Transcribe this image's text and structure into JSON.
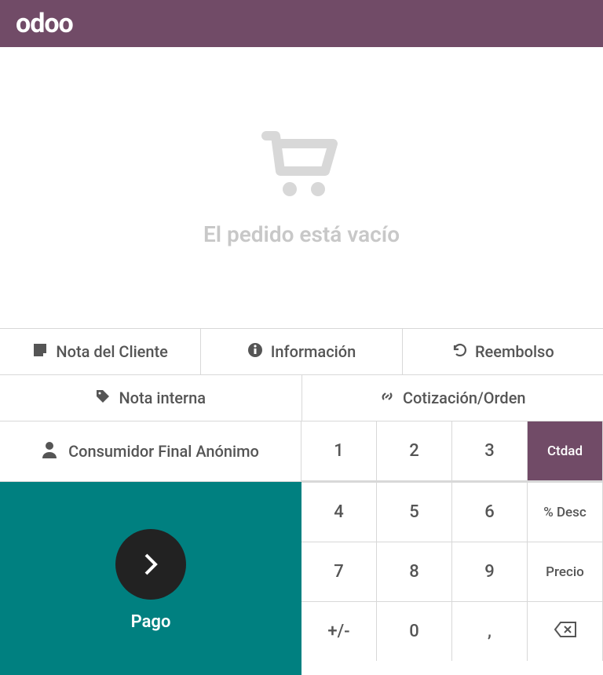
{
  "header": {
    "logo": "odoo"
  },
  "cart": {
    "empty_text": "El pedido está vacío"
  },
  "actions_row1": {
    "customer_note": "Nota del Cliente",
    "info": "Información",
    "refund": "Reembolso"
  },
  "actions_row2": {
    "internal_note": "Nota interna",
    "quotation": "Cotización/Orden"
  },
  "customer": {
    "label": "Consumidor Final Anónimo"
  },
  "numpad": {
    "k1": "1",
    "k2": "2",
    "k3": "3",
    "k4": "4",
    "k5": "5",
    "k6": "6",
    "k7": "7",
    "k8": "8",
    "k9": "9",
    "pm": "+/-",
    "k0": "0",
    "comma": ",",
    "mode_qty": "Ctdad",
    "mode_disc": "% Desc",
    "mode_price": "Precio"
  },
  "payment": {
    "label": "Pago"
  }
}
